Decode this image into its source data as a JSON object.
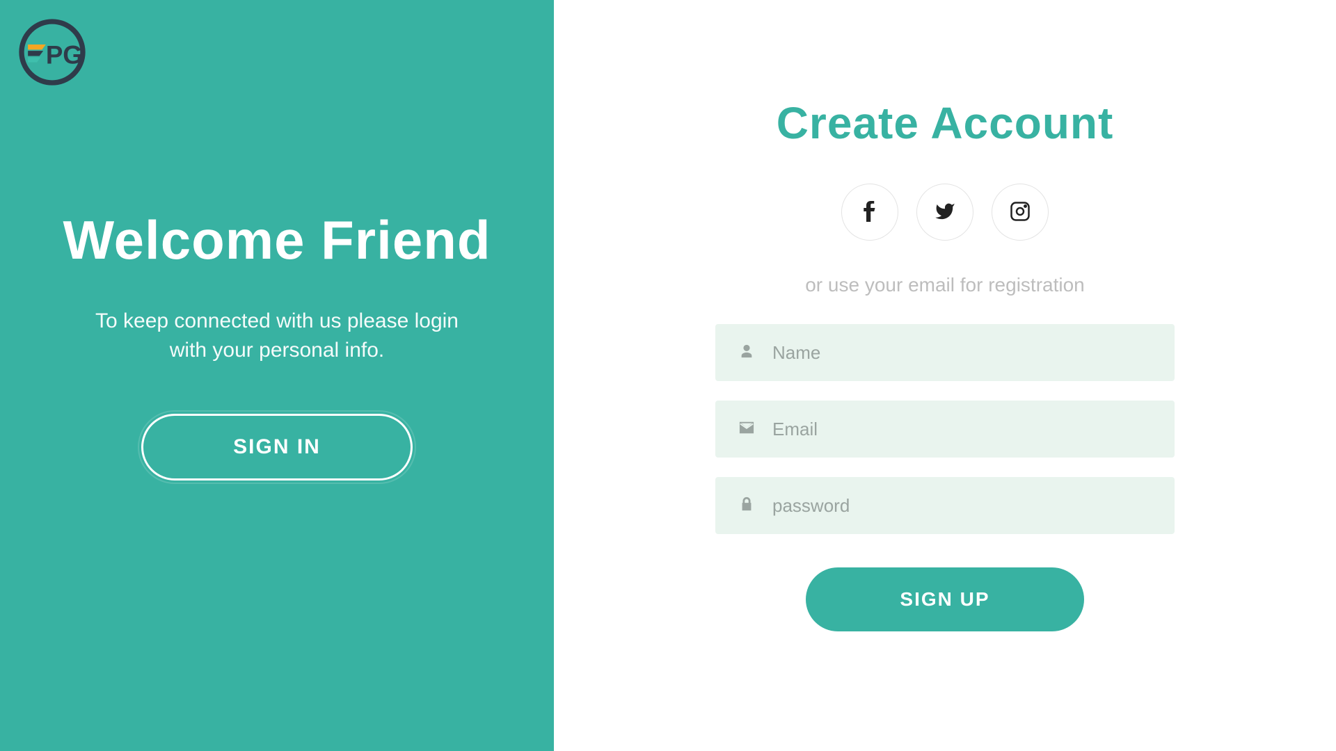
{
  "left": {
    "welcome_title": "Welcome Friend",
    "welcome_sub": "To keep connected with us please login with your personal info.",
    "signin_label": "SIGN IN"
  },
  "right": {
    "create_title": "Create Account",
    "or_text": "or use your email for registration",
    "name_placeholder": "Name",
    "email_placeholder": "Email",
    "password_placeholder": "password",
    "signup_label": "SIGN UP"
  },
  "social": {
    "facebook": "facebook",
    "twitter": "twitter",
    "instagram": "instagram"
  },
  "colors": {
    "accent": "#38b2a2",
    "field_bg": "#e9f4ee",
    "muted": "#bdbdbd"
  }
}
